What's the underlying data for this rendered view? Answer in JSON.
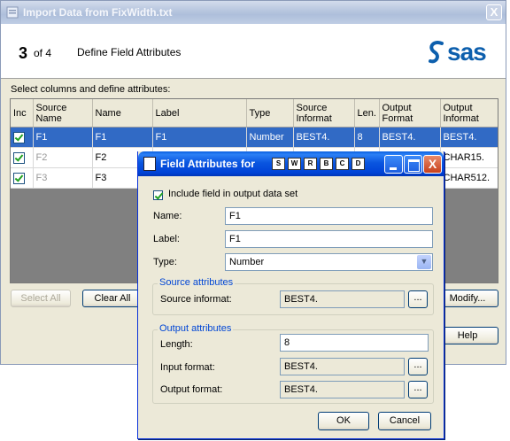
{
  "main": {
    "title": "Import Data from FixWidth.txt",
    "step_number": "3",
    "step_of": "of 4",
    "step_title": "Define Field Attributes",
    "logo_text": "sas",
    "instructions": "Select columns and define attributes:",
    "columns": [
      "Inc",
      "Source Name",
      "Name",
      "Label",
      "Type",
      "Source Informat",
      "Len.",
      "Output Format",
      "Output Informat"
    ],
    "rows": [
      {
        "inc": true,
        "source_name": "F1",
        "name": "F1",
        "label": "F1",
        "type": "Number",
        "source_informat": "BEST4.",
        "len": "8",
        "output_format": "BEST4.",
        "output_informat": "BEST4."
      },
      {
        "inc": true,
        "source_name": "F2",
        "name": "F2",
        "label": "",
        "type": "",
        "source_informat": "",
        "len": "",
        "output_format": "",
        "output_informat": "CHAR15."
      },
      {
        "inc": true,
        "source_name": "F3",
        "name": "F3",
        "label": "",
        "type": "",
        "source_informat": "",
        "len": "",
        "output_format": "",
        "output_informat": "CHAR512."
      }
    ],
    "select_all": "Select All",
    "clear_all": "Clear All",
    "modify": "Modify...",
    "help": "Help",
    "close_glyph": "X"
  },
  "dialog": {
    "title": "Field Attributes for",
    "mini_icons": [
      "S",
      "W",
      "R",
      "B",
      "C",
      "D"
    ],
    "include_label": "Include field in output data set",
    "name_label": "Name:",
    "name_value": "F1",
    "label_label": "Label:",
    "label_value": "F1",
    "type_label": "Type:",
    "type_value": "Number",
    "source_group": "Source attributes",
    "source_informat_label": "Source informat:",
    "source_informat_value": "BEST4.",
    "output_group": "Output attributes",
    "length_label": "Length:",
    "length_value": "8",
    "input_format_label": "Input format:",
    "input_format_value": "BEST4.",
    "output_format_label": "Output format:",
    "output_format_value": "BEST4.",
    "browse_label": "...",
    "ok": "OK",
    "cancel": "Cancel",
    "close_glyph": "X"
  }
}
